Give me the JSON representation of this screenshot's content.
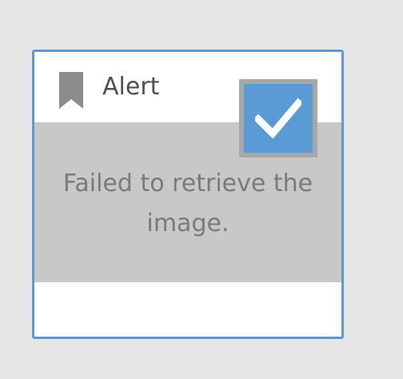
{
  "card": {
    "title": "Alert",
    "image_error": "Failed to retrieve the image.",
    "selected": true
  },
  "icons": {
    "bookmark": "bookmark-icon",
    "check": "check-icon"
  },
  "colors": {
    "accent": "#5b9bd5",
    "placeholder_bg": "#c8c8c8",
    "page_bg": "#e6e6e6"
  }
}
